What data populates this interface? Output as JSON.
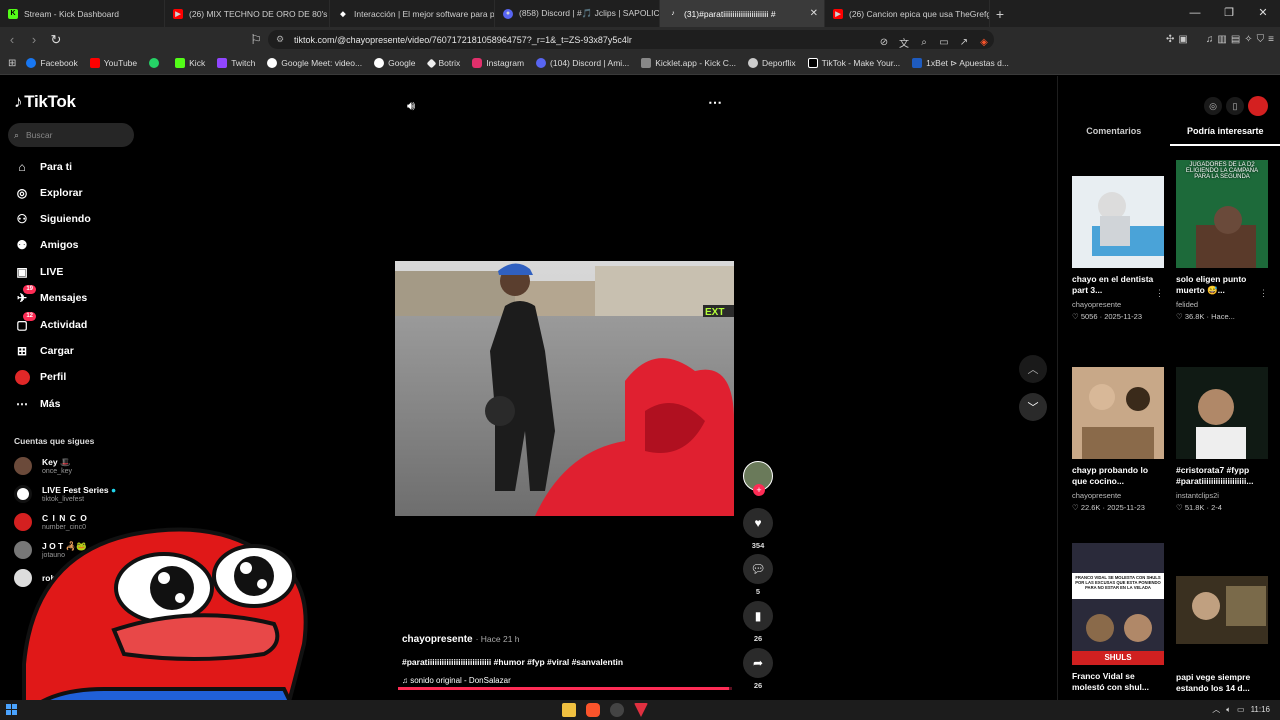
{
  "browser": {
    "tabs": [
      {
        "title": "Stream - Kick Dashboard",
        "icon": "kick-icon",
        "color": "#53fc18"
      },
      {
        "title": "(26) MIX TECHNO DE ORO DE 80's &",
        "icon": "youtube-icon",
        "color": "#ff0000"
      },
      {
        "title": "Interacción | El mejor software para p",
        "icon": "diamond-icon",
        "color": "#ffffff"
      },
      {
        "title": "(858) Discord | #🎵 Jclips | SAPOLIC",
        "icon": "discord-icon",
        "color": "#5865f2"
      },
      {
        "title": "(31)#paratiiiiiiiiiiiiiiiiiiiiiiii #",
        "icon": "tiktok-icon",
        "color": "#ffffff",
        "active": true
      },
      {
        "title": "(26) Cancion epica que usa TheGrefg",
        "icon": "youtube-icon",
        "color": "#ff0000"
      }
    ],
    "new_tab": "+",
    "url": "tiktok.com/@chayopresente/video/7607172181058964757?_r=1&_t=ZS-93x87y5c4lr",
    "bookmarks": [
      {
        "label": "Facebook",
        "color": "#1877f2"
      },
      {
        "label": "YouTube",
        "color": "#ff0000"
      },
      {
        "label": "",
        "color": "#25d366"
      },
      {
        "label": "Kick",
        "color": "#53fc18"
      },
      {
        "label": "Twitch",
        "color": "#9146ff"
      },
      {
        "label": "Google Meet: video...",
        "color": "#00897b"
      },
      {
        "label": "Google",
        "color": "#4285f4"
      },
      {
        "label": "Botrix",
        "color": "#eeeeee"
      },
      {
        "label": "Instagram",
        "color": "#e1306c"
      },
      {
        "label": "(104) Discord | Ami...",
        "color": "#5865f2"
      },
      {
        "label": "Kicklet.app - Kick C...",
        "color": "#888888"
      },
      {
        "label": "Deporflix",
        "color": "#cccccc"
      },
      {
        "label": "TikTok - Make Your...",
        "color": "#ffffff"
      },
      {
        "label": "1xBet ⊳ Apuestas d...",
        "color": "#1e5bbf"
      }
    ]
  },
  "sidebar": {
    "logo": "TikTok",
    "search_placeholder": "Buscar",
    "nav": [
      {
        "label": "Para ti",
        "icon": "home-icon"
      },
      {
        "label": "Explorar",
        "icon": "compass-icon"
      },
      {
        "label": "Siguiendo",
        "icon": "following-icon"
      },
      {
        "label": "Amigos",
        "icon": "friends-icon"
      },
      {
        "label": "LIVE",
        "icon": "live-icon"
      },
      {
        "label": "Mensajes",
        "icon": "messages-icon",
        "badge": "19"
      },
      {
        "label": "Actividad",
        "icon": "activity-icon",
        "badge": "12"
      },
      {
        "label": "Cargar",
        "icon": "upload-icon"
      },
      {
        "label": "Perfil",
        "icon": "profile-icon"
      },
      {
        "label": "Más",
        "icon": "more-icon"
      }
    ],
    "following_title": "Cuentas que sigues",
    "following": [
      {
        "name": "Key 🎩",
        "handle": "once_key"
      },
      {
        "name": "LIVE Fest Series",
        "handle": "tiktok_livefest"
      },
      {
        "name": "C I N C O",
        "handle": "number_cinc0"
      },
      {
        "name": "J O T 🦂🐸",
        "handle": "jotauno"
      },
      {
        "name": "rob",
        "handle": ""
      }
    ]
  },
  "video": {
    "overlay_text": "EXT",
    "likes": "354",
    "comments": "5",
    "saves": "26",
    "shares": "26",
    "author": "chayopresente",
    "time": "· Hace 21 h",
    "tags": "#paratiiiiiiiiiiiiiiiiiiiiiiiiiii #humor #fyp #viral #sanvalentin",
    "sound": "sonido original - DonSalazar",
    "progress": 0.99
  },
  "right_panel": {
    "tabs": [
      "Comentarios",
      "Podría interesarte"
    ],
    "cards": [
      {
        "title": "chayo en el dentista part 3...",
        "user": "chayopresente",
        "likes": "5056",
        "date": "2025-11-23"
      },
      {
        "title": "solo eligen punto muerto 😅...",
        "user": "felided",
        "likes": "36.8K",
        "date": "Hace..."
      },
      {
        "title": "chayp probando lo que cocino...",
        "user": "chayopresente",
        "likes": "22.6K",
        "date": "2025-11-23"
      },
      {
        "title": "#cristorata7 #fypp #paratiiiiiiiiiiiiiiiiiii...",
        "user": "instantclips2i",
        "likes": "51.8K",
        "date": "2-4"
      },
      {
        "title": "Franco Vidal se molestó con shul...",
        "user": "",
        "likes": "",
        "date": ""
      },
      {
        "title": "papi vege siempre estando los 14 d...",
        "user": "",
        "likes": "",
        "date": ""
      }
    ],
    "thumb_texts": [
      "JUGADORES DE LA D2 ELIGIENDO LA CAMPAÑA PARA LA SEGUNDA",
      "FRANCO VIDAL SE MOLESTA CON SHULS POR LAS EXCUSAS QUE ESTA PONIENDO PARA NO ESTAR EN LA VELADA",
      "SHULS"
    ]
  },
  "taskbar": {
    "time": "11:16"
  }
}
